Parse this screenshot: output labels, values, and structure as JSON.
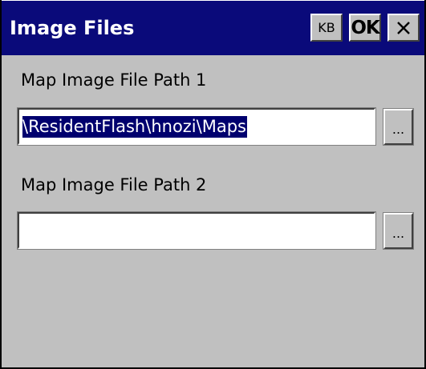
{
  "window": {
    "title": "Image Files",
    "buttons": {
      "keyboard_label": "KB",
      "ok_label": "OK",
      "close_icon": "close-icon"
    }
  },
  "form": {
    "path1": {
      "label": "Map Image File Path 1",
      "value": "\\ResidentFlash\\hnozi\\Maps",
      "browse_label": "..."
    },
    "path2": {
      "label": "Map Image File Path 2",
      "value": "",
      "browse_label": "..."
    }
  },
  "colors": {
    "titlebar": "#0a0a7a",
    "face": "#c0c0c0",
    "selection": "#00006e"
  }
}
